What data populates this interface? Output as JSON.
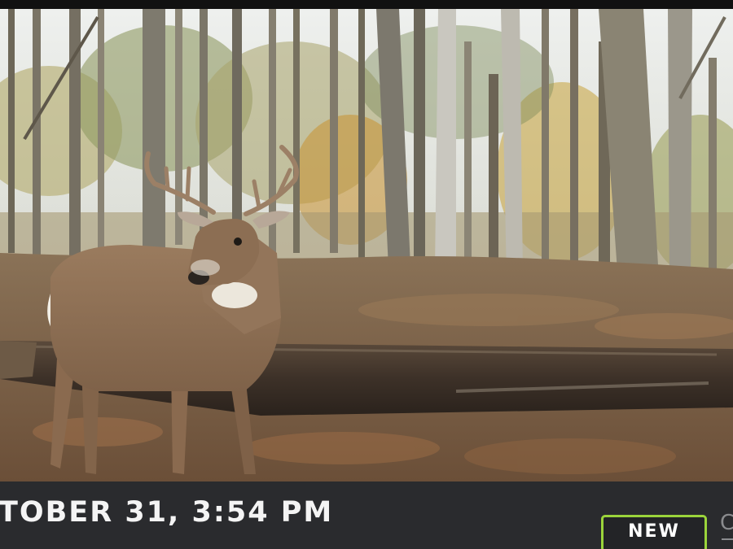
{
  "caption": {
    "date_time": "TOBER 31, 3:54 PM"
  },
  "badge": {
    "label": "NEW",
    "border_color": "#9bd43b"
  },
  "edge_glyph": "C",
  "photo": {
    "subject": "trail-camera-photo"
  }
}
